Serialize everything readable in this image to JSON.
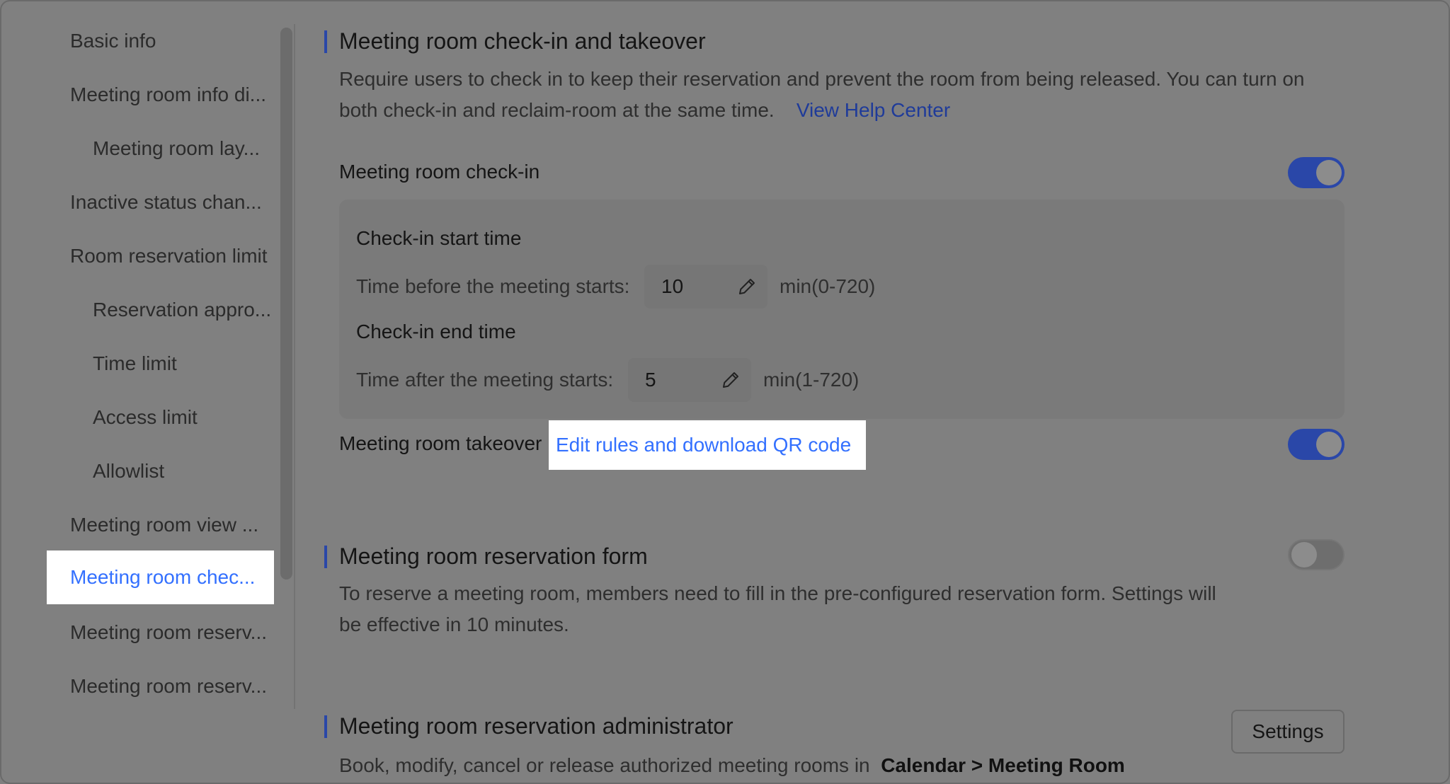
{
  "sidebar": {
    "items": [
      {
        "label": "Basic info"
      },
      {
        "label": "Meeting room info di..."
      },
      {
        "label": "Meeting room lay..."
      },
      {
        "label": "Inactive status chan..."
      },
      {
        "label": "Room reservation limit"
      },
      {
        "label": "Reservation appro..."
      },
      {
        "label": "Time limit"
      },
      {
        "label": "Access limit"
      },
      {
        "label": "Allowlist"
      },
      {
        "label": "Meeting room view ..."
      },
      {
        "label": "Meeting room chec..."
      },
      {
        "label": "Meeting room reserv..."
      },
      {
        "label": "Meeting room reserv..."
      }
    ],
    "active_index": 10
  },
  "checkin_section": {
    "title": "Meeting room check-in and takeover",
    "description": "Require users to check in to keep their reservation and prevent the room from being released. You can turn on both check-in and reclaim-room at the same time.",
    "help_link": "View Help Center",
    "checkin": {
      "label": "Meeting room check-in",
      "enabled": true,
      "start": {
        "heading": "Check-in start time",
        "label": "Time before the meeting starts:",
        "value": "10",
        "range": "min(0-720)"
      },
      "end": {
        "heading": "Check-in end time",
        "label": "Time after the meeting starts:",
        "value": "5",
        "range": "min(1-720)"
      }
    },
    "takeover": {
      "label": "Meeting room takeover",
      "link": "Edit rules and download QR code",
      "enabled": true
    }
  },
  "reservation_form": {
    "title": "Meeting room reservation form",
    "description": "To reserve a meeting room, members need to fill in the pre-configured reservation form. Settings will be effective in 10 minutes.",
    "enabled": false
  },
  "reservation_admin": {
    "title": "Meeting room reservation administrator",
    "description_prefix": "Book, modify, cancel or release authorized meeting rooms in",
    "description_path": "Calendar > Meeting Room",
    "button": "Settings"
  },
  "colors": {
    "accent": "#3370ff",
    "toggle_on": "#2a47a8",
    "overlay": "#808080"
  },
  "icons": [
    "pencil-icon"
  ]
}
